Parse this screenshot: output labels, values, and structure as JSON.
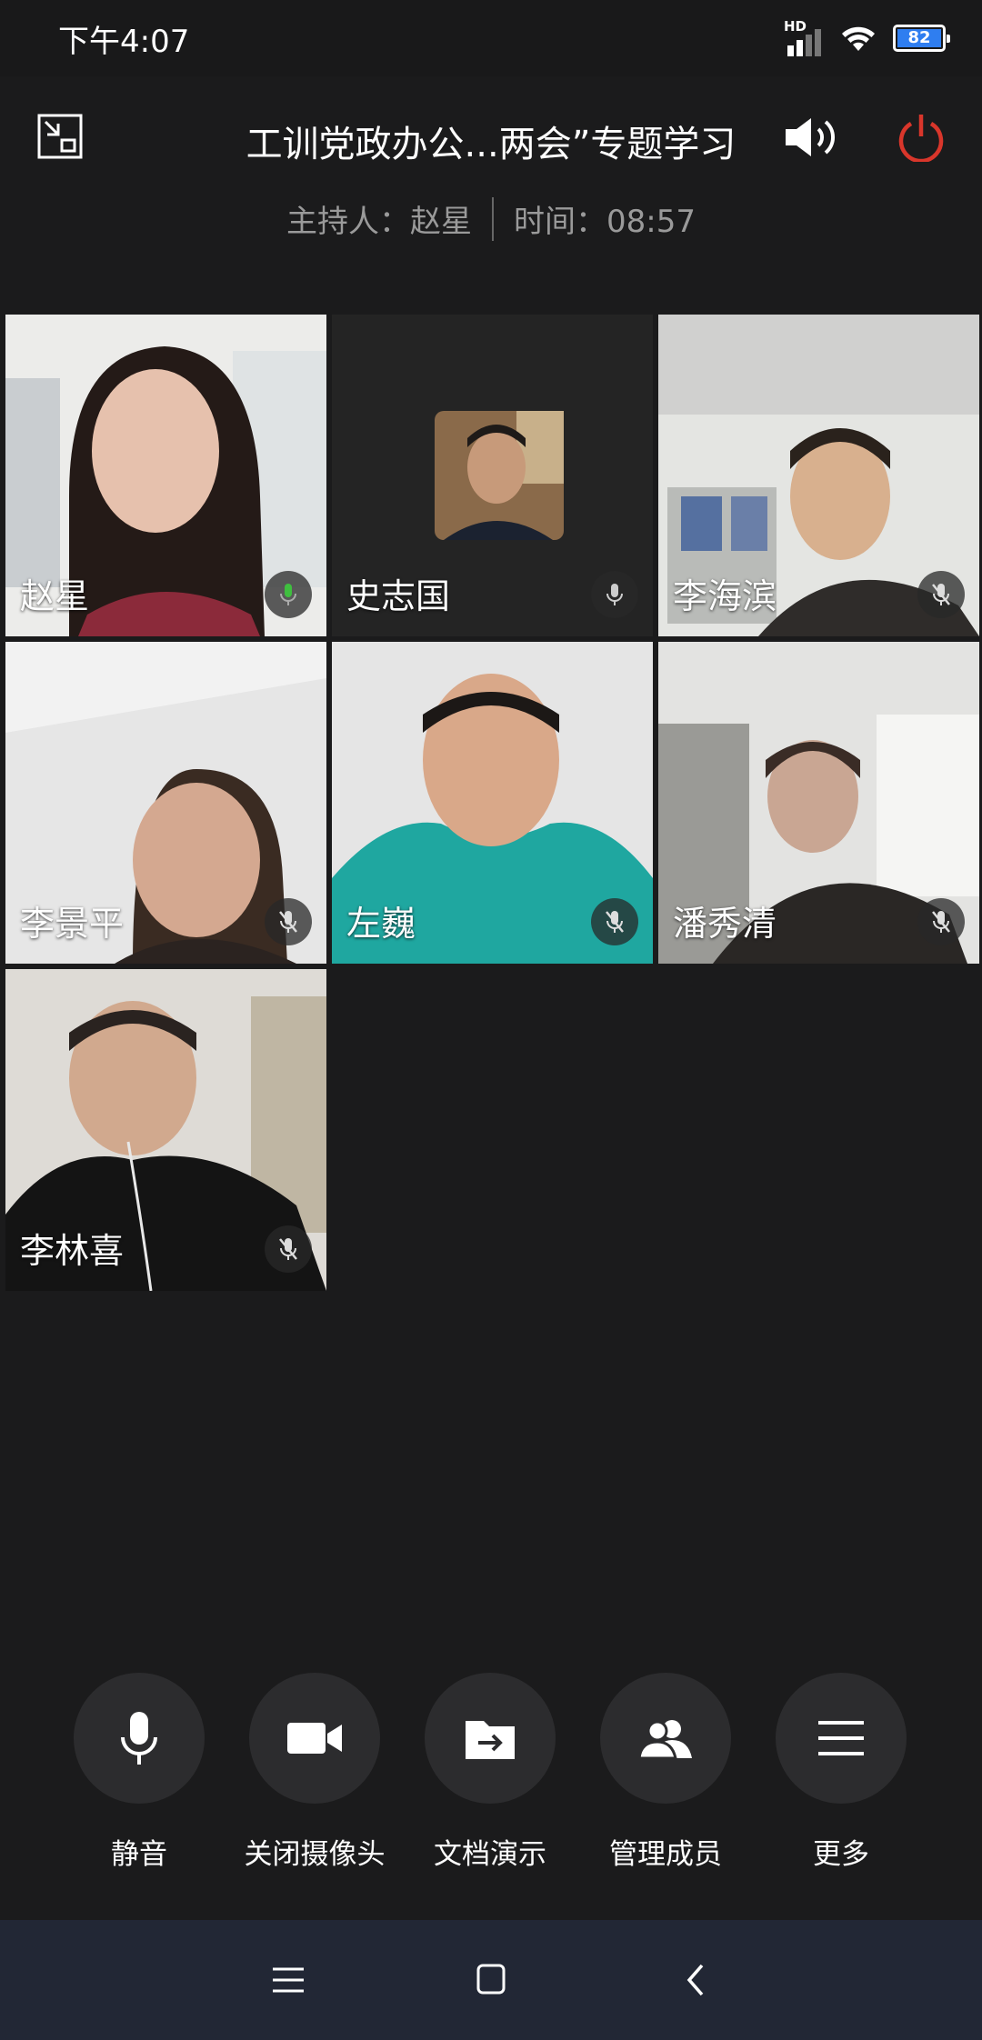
{
  "status_bar": {
    "time": "下午4:07",
    "network": "HD",
    "battery": "82"
  },
  "header": {
    "title": "工训党政办公...两会”专题学习",
    "host_label": "主持人：赵星",
    "time_label": "时间：08:57"
  },
  "participants": [
    {
      "name": "赵星",
      "mic": "active"
    },
    {
      "name": "史志国",
      "mic": "on"
    },
    {
      "name": "李海滨",
      "mic": "muted"
    },
    {
      "name": "李景平",
      "mic": "muted"
    },
    {
      "name": "左巍",
      "mic": "muted"
    },
    {
      "name": "潘秀清",
      "mic": "muted"
    },
    {
      "name": "李林喜",
      "mic": "muted"
    }
  ],
  "toolbar": {
    "mute": "静音",
    "camera": "关闭摄像头",
    "share": "文档演示",
    "members": "管理成员",
    "more": "更多"
  },
  "colors": {
    "power": "#d9362b",
    "background": "#1b1b1c",
    "mic_active": "#3fbf3f",
    "battery": "#2f7ef0"
  }
}
